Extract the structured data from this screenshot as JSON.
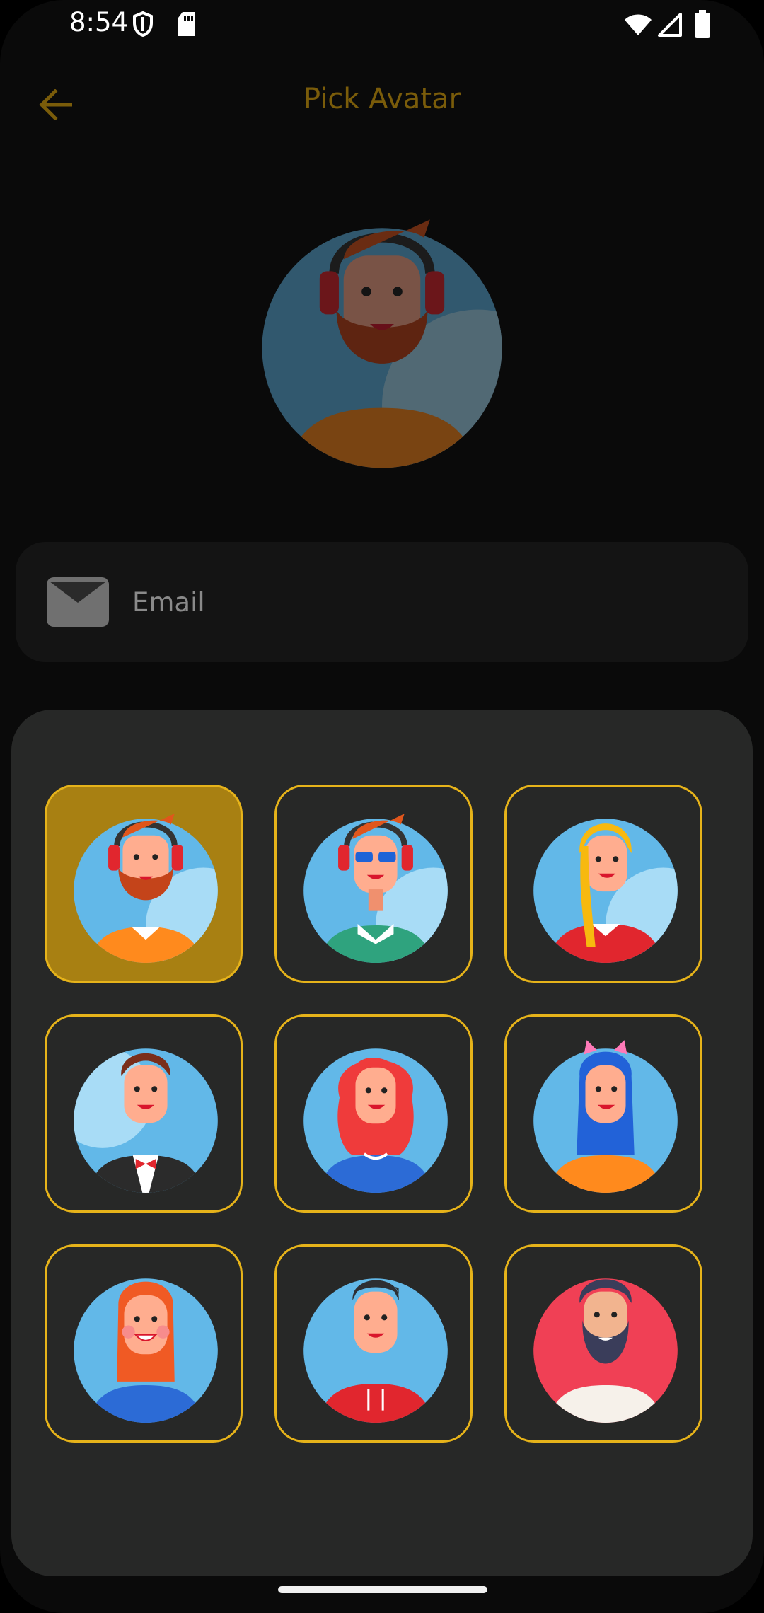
{
  "status_bar": {
    "time": "8:54",
    "icons": [
      "shield-icon",
      "sd-card-icon",
      "wifi-icon",
      "cell-signal-icon",
      "battery-icon"
    ]
  },
  "app_bar": {
    "back_icon": "arrow-left-icon",
    "title": "Pick Avatar"
  },
  "selected_avatar": {
    "name": "bearded-man-headphones",
    "dimmed": true
  },
  "email_field": {
    "icon": "mail-icon",
    "placeholder": "Email",
    "value": ""
  },
  "avatar_grid": {
    "selected_index": 0,
    "items": [
      {
        "name": "bearded-man-headphones"
      },
      {
        "name": "man-sunglasses-headphones"
      },
      {
        "name": "blonde-woman-hoodie"
      },
      {
        "name": "man-bowtie-tuxedo"
      },
      {
        "name": "red-hair-woman-earphones"
      },
      {
        "name": "blue-hair-girl-cat-ears"
      },
      {
        "name": "redhead-woman"
      },
      {
        "name": "man-red-hoodie"
      },
      {
        "name": "bearded-man-red-background"
      }
    ]
  },
  "colors": {
    "accent": "#e6b31a",
    "selected_tile": "#a88012",
    "title": "#7a5c0a",
    "sheet": "#272827",
    "background": "#0a0a0a"
  }
}
